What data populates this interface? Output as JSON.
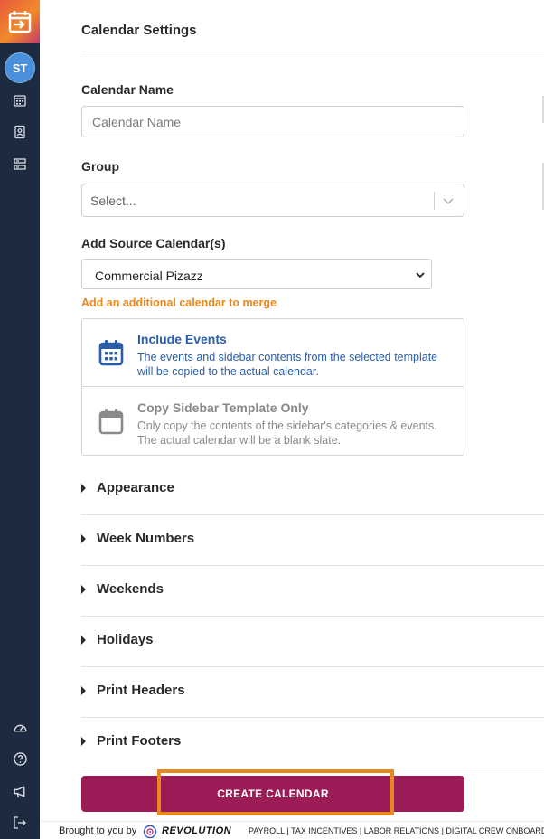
{
  "user": {
    "initials": "ST"
  },
  "page": {
    "title": "Calendar Settings"
  },
  "form": {
    "calendar_name": {
      "label": "Calendar Name",
      "placeholder": "Calendar Name",
      "value": ""
    },
    "group": {
      "label": "Group",
      "placeholder": "Select..."
    },
    "source": {
      "label": "Add Source Calendar(s)",
      "selected": "Commercial Pizazz",
      "merge_link": "Add an additional calendar to merge"
    },
    "options": [
      {
        "title": "Include Events",
        "description": "The events and sidebar contents from the selected template will be copied to the actual calendar."
      },
      {
        "title": "Copy Sidebar Template Only",
        "description": "Only copy the contents of the sidebar's categories & events. The actual calendar will be a blank slate."
      }
    ]
  },
  "sections": [
    "Appearance",
    "Week Numbers",
    "Weekends",
    "Holidays",
    "Print Headers",
    "Print Footers"
  ],
  "actions": {
    "create_label": "CREATE CALENDAR"
  },
  "footer": {
    "brought": "Brought to you by",
    "brand": "REVOLUTION",
    "links": "PAYROLL | TAX INCENTIVES | LABOR RELATIONS | DIGITAL CREW ONBOARDING | S"
  },
  "colors": {
    "sidebar": "#1c2b3f",
    "accent": "#e8891d",
    "primary": "#9b1c57",
    "link": "#2a5ea8",
    "avatar": "#4a8fd9"
  }
}
